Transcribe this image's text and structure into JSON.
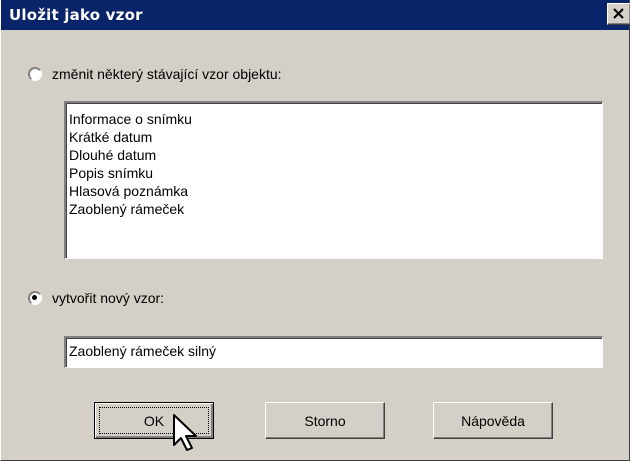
{
  "dialog": {
    "title": "Uložit jako vzor"
  },
  "options": {
    "modify": {
      "label": "změnit některý stávající vzor objektu:",
      "checked": false,
      "templates": [
        "Informace o snímku",
        "Krátké datum",
        "Dlouhé datum",
        "Popis snímku",
        "Hlasová poznámka",
        "Zaoblený rámeček"
      ]
    },
    "create": {
      "label": "vytvořit nový vzor:",
      "checked": true,
      "name_value": "Zaoblený rámeček silný"
    }
  },
  "buttons": {
    "ok": "OK",
    "cancel": "Storno",
    "help": "Nápověda"
  },
  "icons": {
    "close": "close-icon",
    "cursor": "arrow-cursor-icon"
  },
  "colors": {
    "titlebar": "#0a246a",
    "dialog_bg": "#d4d0c8"
  }
}
